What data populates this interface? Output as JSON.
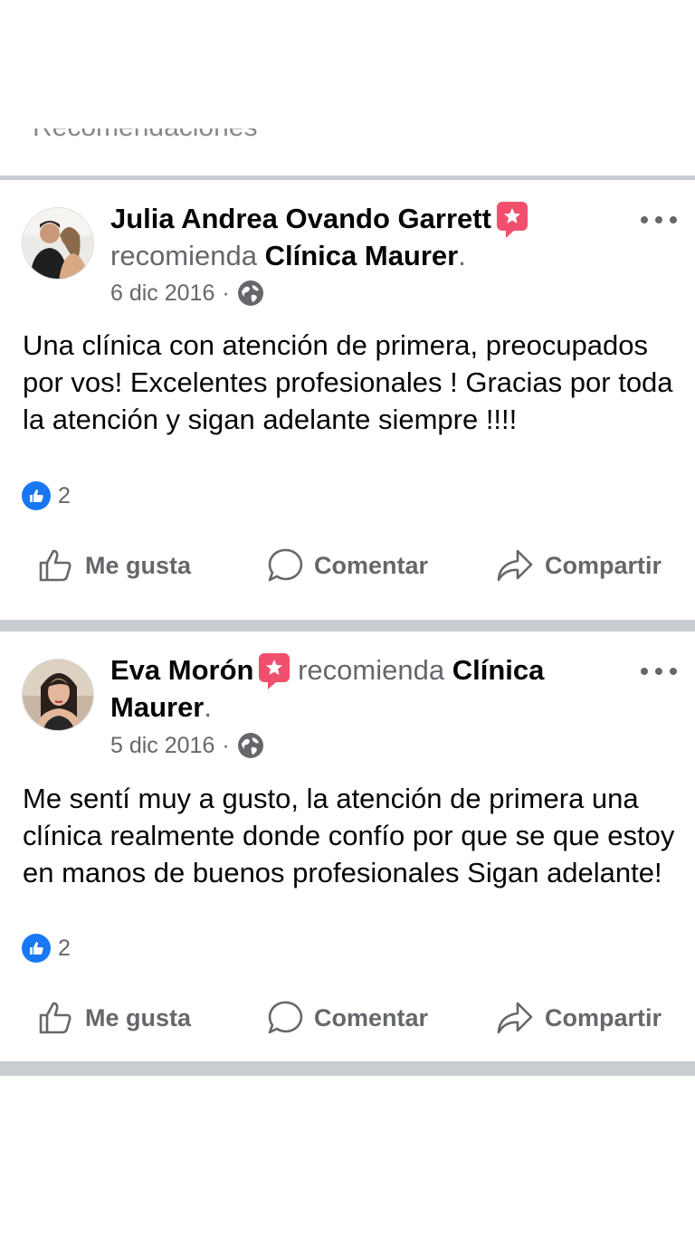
{
  "top_fragment": "Recomendaciones",
  "posts": [
    {
      "author": "Julia Andrea Ovando Garrett",
      "verb": "recomienda",
      "page": "Clínica Maurer",
      "date": "6 dic 2016",
      "text": "Una clínica con atención de primera, preocupados por vos! Excelentes profesionales ! Gracias por toda la atención y sigan adelante siempre !!!!",
      "like_count": "2"
    },
    {
      "author": "Eva Morón",
      "verb": "recomienda",
      "page": "Clínica",
      "page_cont": "Maurer",
      "date": "5 dic 2016",
      "text": "Me sentí muy a gusto, la atención de primera una clínica realmente donde confío por que se que estoy en manos de buenos profesionales Sigan adelante!",
      "like_count": "2"
    }
  ],
  "actions": {
    "like": "Me gusta",
    "comment": "Comentar",
    "share": "Compartir"
  },
  "colors": {
    "accent": "#1877f2",
    "badge": "#f0506e",
    "divider": "#c9ccd1",
    "secondary_text": "#65676b"
  }
}
